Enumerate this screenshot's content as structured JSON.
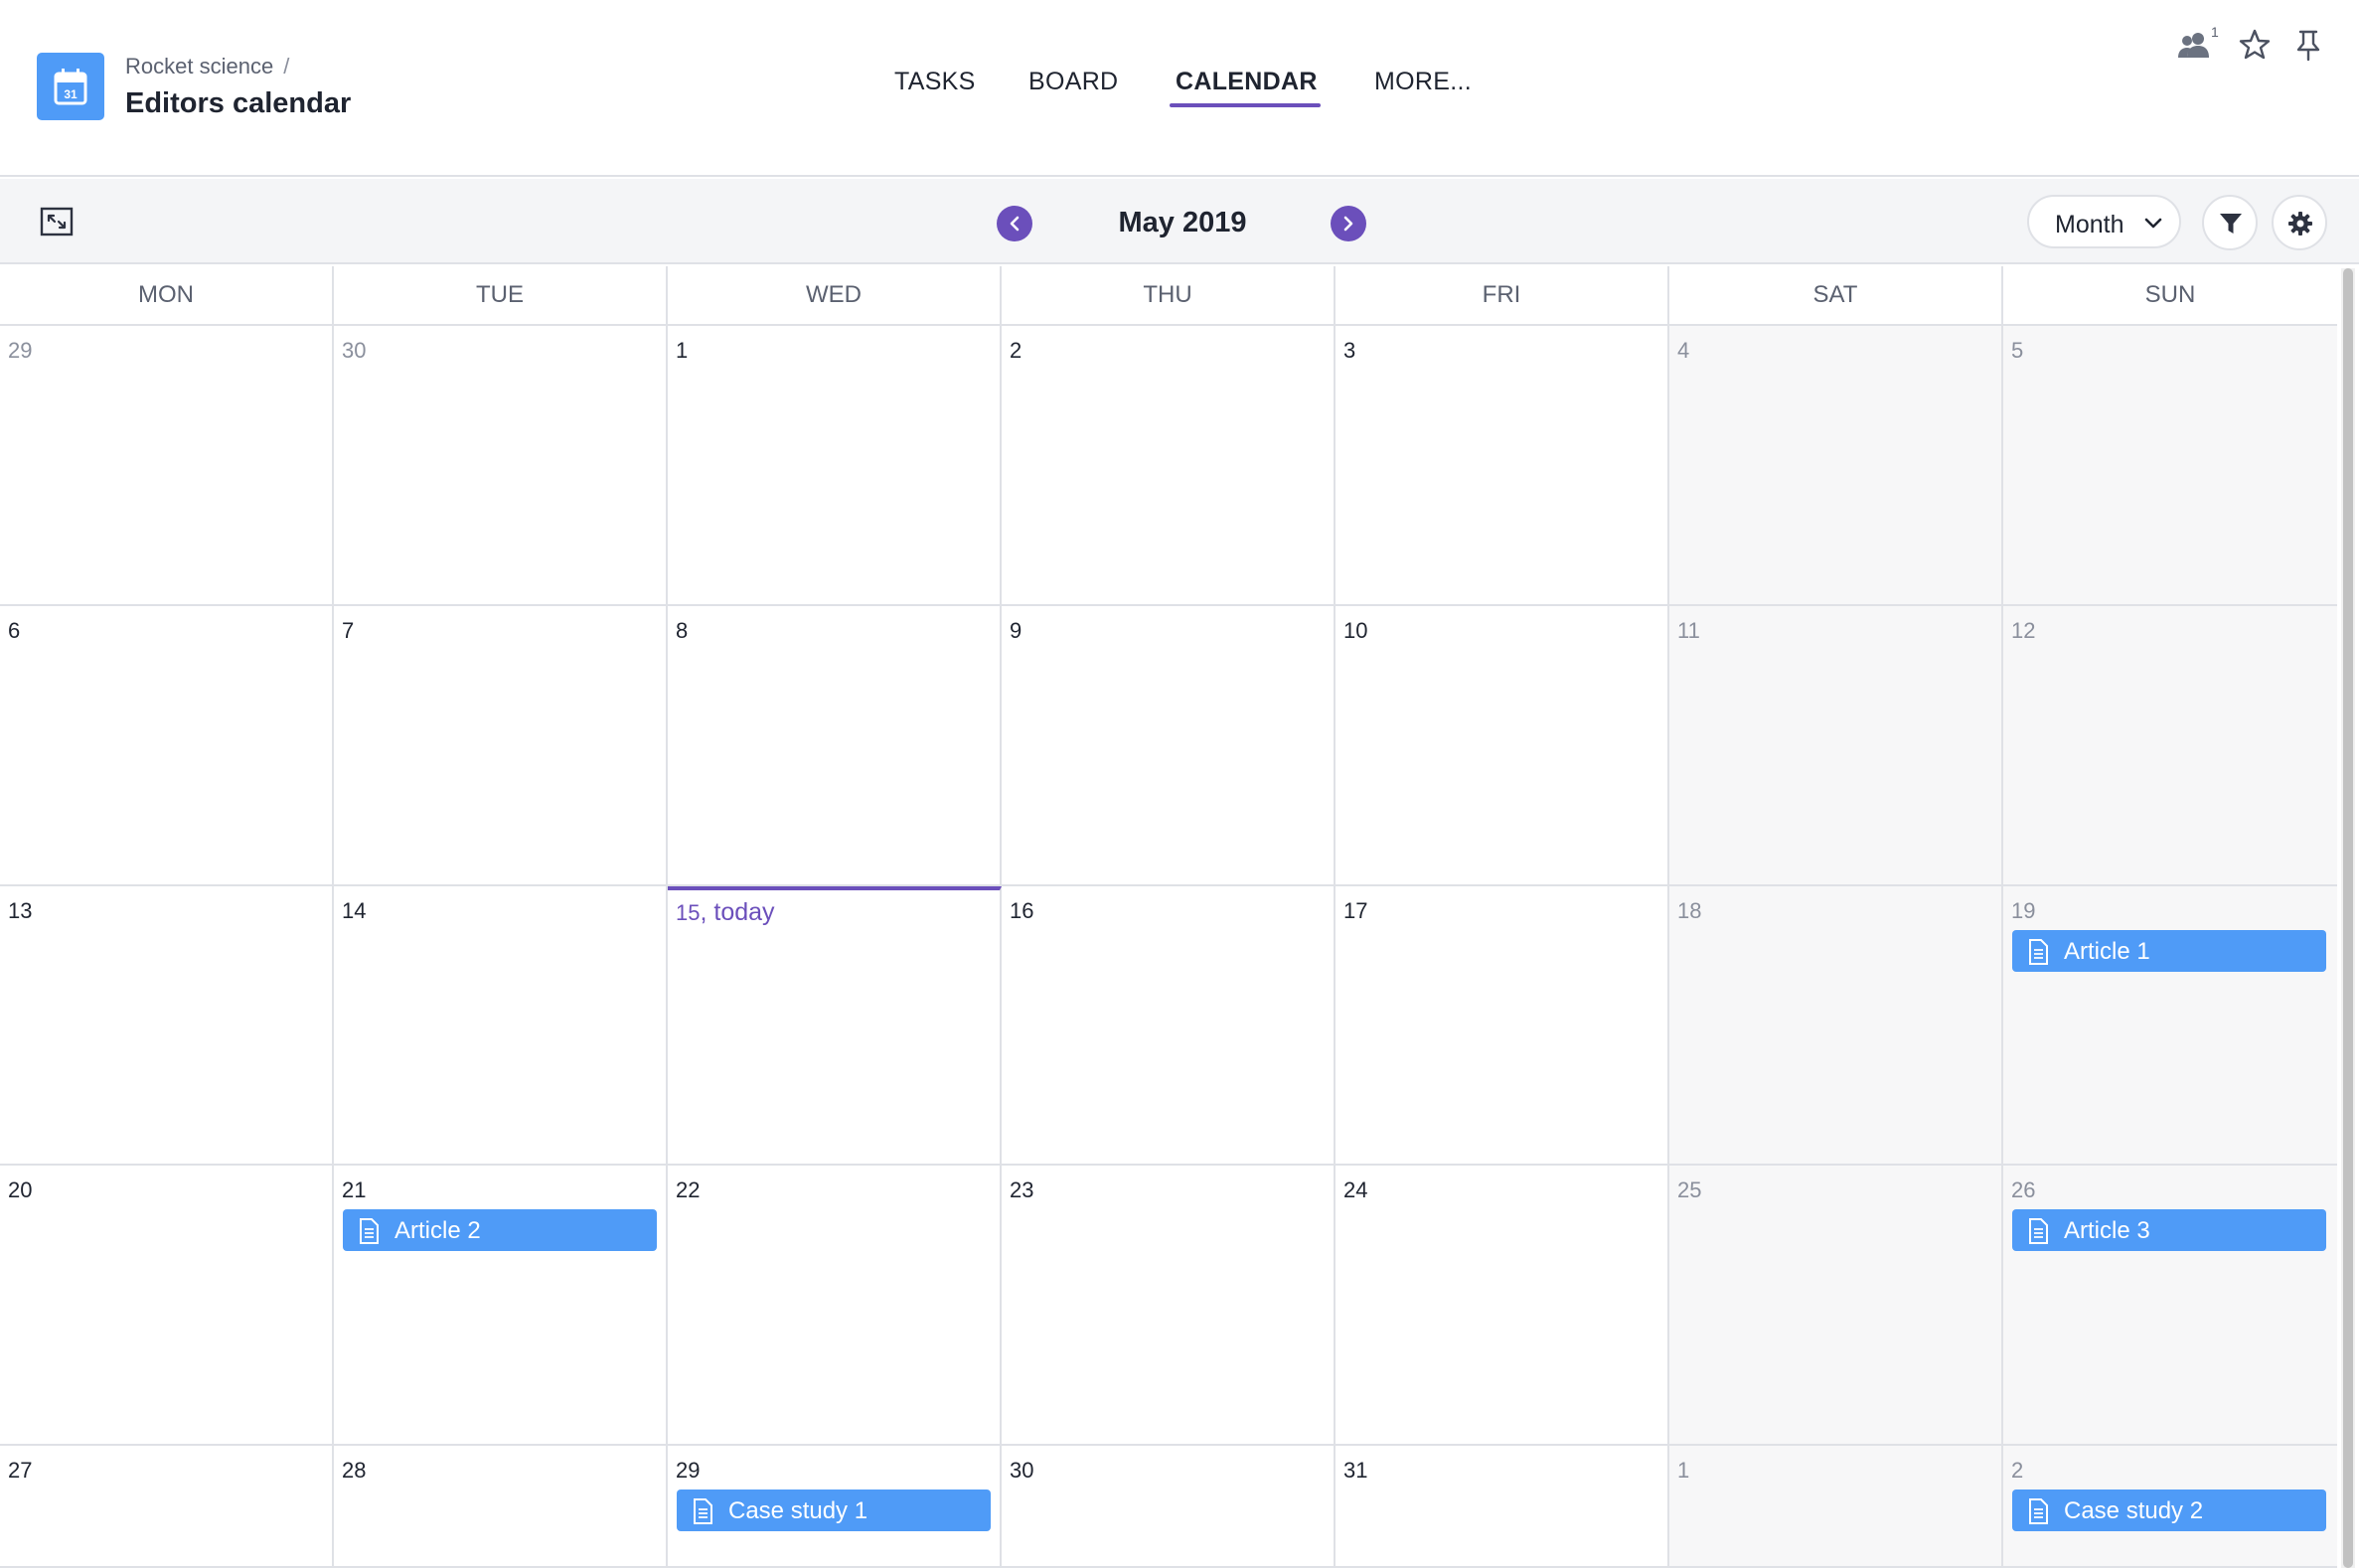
{
  "header": {
    "breadcrumb": "Rocket science",
    "breadcrumb_sep": "/",
    "title": "Editors calendar",
    "app_icon_day": "31",
    "members_count": "1"
  },
  "tabs": [
    {
      "label": "TASKS",
      "active": false
    },
    {
      "label": "BOARD",
      "active": false
    },
    {
      "label": "CALENDAR",
      "active": true
    },
    {
      "label": "MORE...",
      "active": false
    }
  ],
  "toolbar": {
    "month_label": "May 2019",
    "view": "Month"
  },
  "weekdays": [
    "MON",
    "TUE",
    "WED",
    "THU",
    "FRI",
    "SAT",
    "SUN"
  ],
  "weeks": [
    [
      "29",
      "30",
      "1",
      "2",
      "3",
      "4",
      "5"
    ],
    [
      "6",
      "7",
      "8",
      "9",
      "10",
      "11",
      "12"
    ],
    [
      "13",
      "14",
      "15",
      "16",
      "17",
      "18",
      "19"
    ],
    [
      "20",
      "21",
      "22",
      "23",
      "24",
      "25",
      "26"
    ],
    [
      "27",
      "28",
      "29",
      "30",
      "31",
      "1",
      "2"
    ]
  ],
  "today": {
    "day": "15",
    "suffix": ", today"
  },
  "events": [
    {
      "title": "Article 1",
      "week": 2,
      "weekday": 6
    },
    {
      "title": "Article 2",
      "week": 3,
      "weekday": 1
    },
    {
      "title": "Article 3",
      "week": 3,
      "weekday": 6
    },
    {
      "title": "Case study 1",
      "week": 4,
      "weekday": 2
    },
    {
      "title": "Case study 2",
      "week": 4,
      "weekday": 6
    }
  ],
  "colors": {
    "accent": "#6b4fbb",
    "event": "#4f9bf7",
    "app_icon": "#4f9bf7"
  }
}
